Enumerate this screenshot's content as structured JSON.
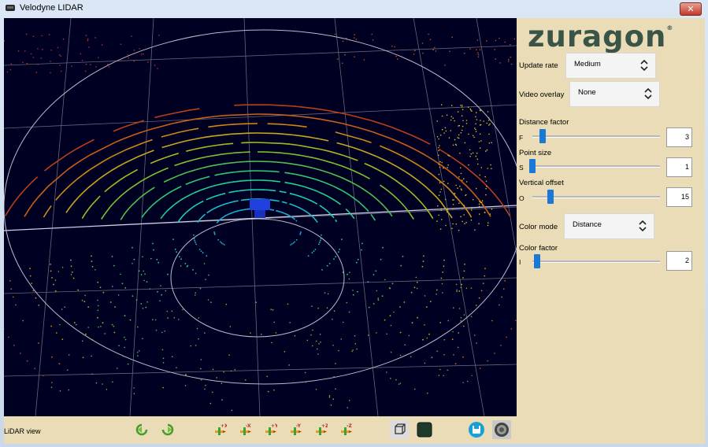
{
  "window": {
    "title": "Velodyne LIDAR",
    "close_label": "✕"
  },
  "logo": {
    "text": "zuragon",
    "mark": "®"
  },
  "controls": {
    "update_rate": {
      "label": "Update rate",
      "value": "Medium"
    },
    "video_overlay": {
      "label": "Video overlay",
      "value": "None"
    },
    "distance_factor": {
      "label": "Distance factor",
      "letter": "F",
      "value": "3",
      "level": 0.06
    },
    "point_size": {
      "label": "Point size",
      "letter": "S",
      "value": "1",
      "level": 0.0
    },
    "vertical_offset": {
      "label": "Vertical offset",
      "letter": "O",
      "value": "15",
      "level": 0.15
    },
    "color_mode": {
      "label": "Color mode",
      "value": "Distance"
    },
    "color_factor": {
      "label": "Color factor",
      "letter": "I",
      "value": "2",
      "level": 0.02
    }
  },
  "footer": {
    "view_label": "LiDAR view",
    "tools": [
      {
        "name": "rotate-left",
        "label": ""
      },
      {
        "name": "rotate-right",
        "label": ""
      },
      {
        "name": "plus-x",
        "label": "+X"
      },
      {
        "name": "minus-x",
        "label": "-X"
      },
      {
        "name": "plus-y",
        "label": "+Y"
      },
      {
        "name": "minus-y",
        "label": "-Y"
      },
      {
        "name": "plus-z",
        "label": "+Z"
      },
      {
        "name": "minus-z",
        "label": "-Z"
      }
    ]
  },
  "colors": {
    "accent": "#1a78d6",
    "panel": "#e9dcb6",
    "viewport_bg": "#000022"
  }
}
